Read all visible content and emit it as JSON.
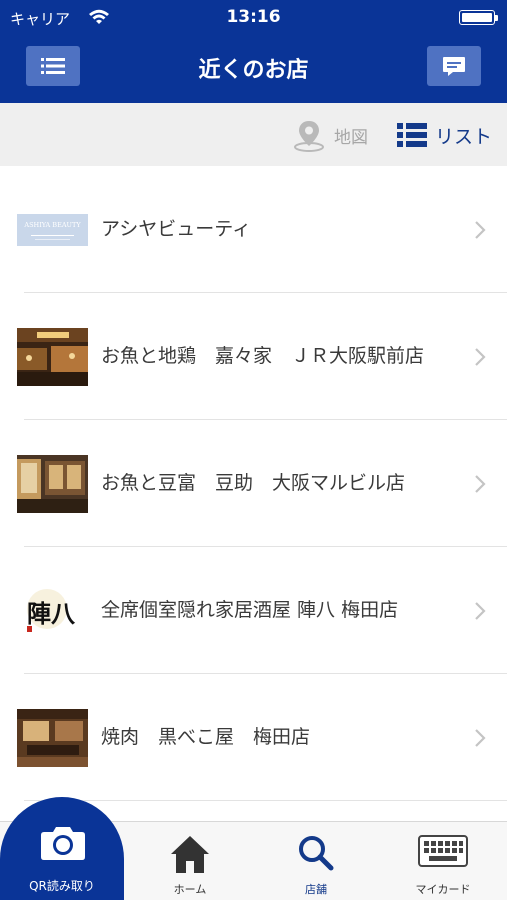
{
  "status_bar": {
    "carrier": "キャリア",
    "time": "13:16"
  },
  "nav": {
    "title": "近くのお店",
    "left_icon": "menu-list-icon",
    "right_icon": "message-icon"
  },
  "view_toggle": {
    "map_label": "地図",
    "list_label": "リスト",
    "selected": "list",
    "active_color": "#143a8a",
    "inactive_color": "#a7a7a7"
  },
  "shops": [
    {
      "name": "アシヤビューティ",
      "thumb_text": "ASHIYA BEAUTY"
    },
    {
      "name": "お魚と地鶏　嘉々家　ＪＲ大阪駅前店"
    },
    {
      "name": "お魚と豆富　豆助　大阪マルビル店"
    },
    {
      "name": "全席個室隠れ家居酒屋 陣八 梅田店",
      "thumb_text": "陣八"
    },
    {
      "name": "焼肉　黒べこ屋　梅田店"
    }
  ],
  "tabs": {
    "qr": "QR読み取り",
    "home": "ホーム",
    "shops": "店舗",
    "mycard": "マイカード",
    "active": "shops"
  },
  "colors": {
    "brand": "#0a3497",
    "nav_button": "#4f72c2"
  }
}
